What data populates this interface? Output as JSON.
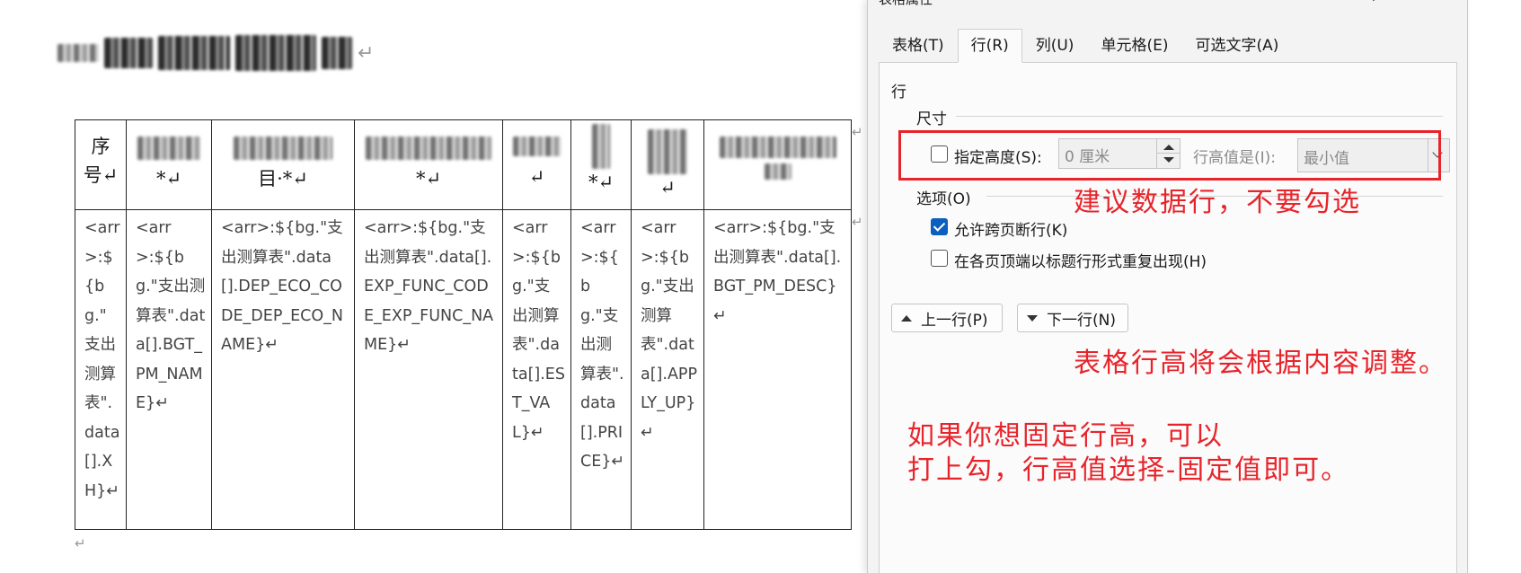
{
  "document": {
    "title_mark": "↵",
    "left_margin_mark": "↵",
    "header": [
      {
        "line1": "序",
        "line2": "号↵"
      },
      {
        "line1": "",
        "line2": "*↵"
      },
      {
        "line1": "",
        "line2": "目·*↵"
      },
      {
        "line1": "",
        "line2": "*↵"
      },
      {
        "line1": "",
        "line2": "↵"
      },
      {
        "line1": "",
        "line2": "*↵"
      },
      {
        "line1": "",
        "line2": "↵"
      },
      {
        "line1": "",
        "line2": ""
      }
    ],
    "cells": [
      "<arr>:${bg.\"支出测算表\".data[].XH}↵",
      "<arr>:${bg.\"支出测算表\".data[].BGT_PM_NAME}↵",
      "<arr>:${bg.\"支出测算表\".data[].DEP_ECO_CODE_DEP_ECO_NAME}↵",
      "<arr>:${bg.\"支出测算表\".data[].EXP_FUNC_CODE_EXP_FUNC_NAME}↵",
      "<arr>:${bg.\"支出测算表\".data[].EST_VAL}↵",
      "<arr>:${bg.\"支出测算表\".data[].PRICE}↵",
      "<arr>:${bg.\"支出测算表\".data[].APPLY_UP}↵",
      "<arr>:${bg.\"支出测算表\".data[].BGT_PM_DESC}↵"
    ],
    "row_end_marks": [
      "↵",
      "↵"
    ],
    "end_mark": "↵"
  },
  "dialog": {
    "title": "表格属性",
    "help": "?",
    "close": "✕",
    "tabs": [
      {
        "label": "表格(T)",
        "key": "T"
      },
      {
        "label": "行(R)",
        "key": "R"
      },
      {
        "label": "列(U)",
        "key": "U"
      },
      {
        "label": "单元格(E)",
        "key": "E"
      },
      {
        "label": "可选文字(A)",
        "key": "A"
      }
    ],
    "row_label": "行",
    "size_section": "尺寸",
    "specify_height": {
      "label": "指定高度(S):",
      "checked": false
    },
    "height_value": "0 厘米",
    "row_height_is_label": "行高值是(I):",
    "row_height_is_value": "最小值",
    "options_section": "选项(O)",
    "allow_break": {
      "label": "允许跨页断行(K)",
      "checked": true
    },
    "repeat_header": {
      "label": "在各页顶端以标题行形式重复出现(H)",
      "checked": false
    },
    "prev_row": "上一行(P)",
    "next_row": "下一行(N)"
  },
  "annotations": {
    "note1": "建议数据行，不要勾选",
    "note2": "表格行高将会根据内容调整。",
    "note3_line1": "如果你想固定行高，可以",
    "note3_line2": "打上勾，行高值选择-固定值即可。",
    "color": "#e8242b"
  }
}
